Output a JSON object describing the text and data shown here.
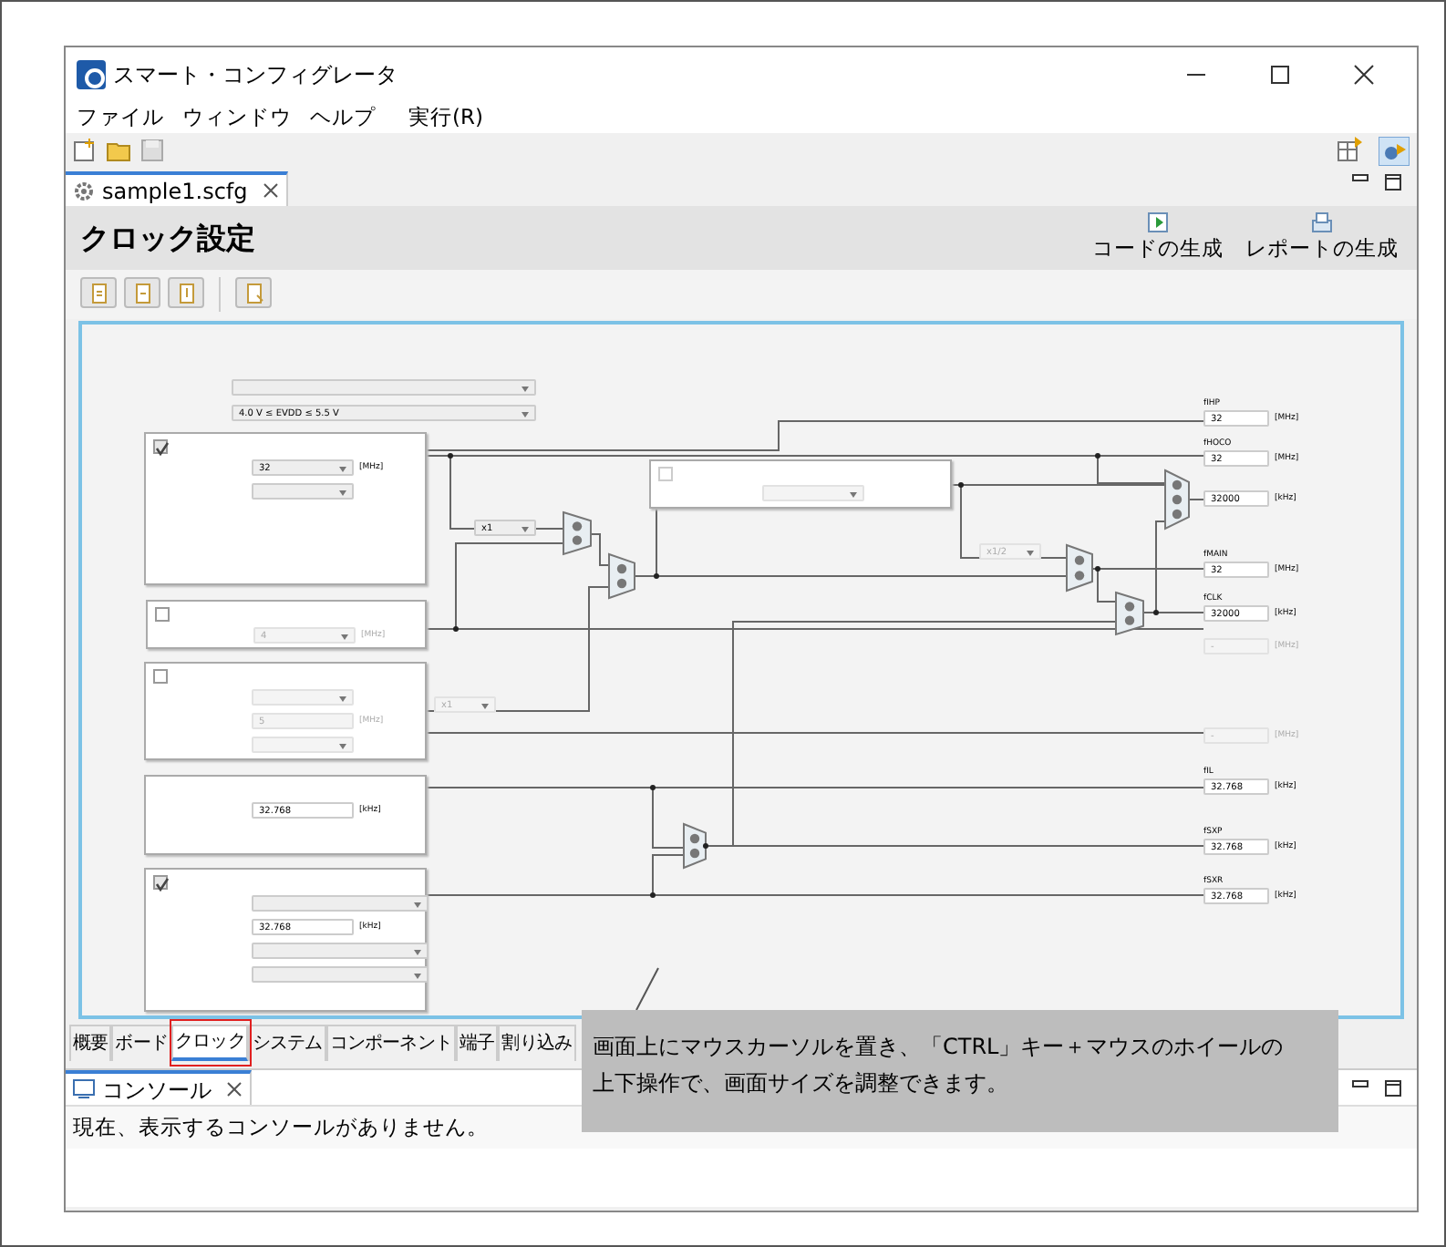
{
  "window": {
    "title": "スマート・コンフィグレータ"
  },
  "menu": [
    "ファイル",
    "ウィンドウ",
    "ヘルプ",
    "実行(R)"
  ],
  "editor_tab": {
    "label": "sample1.scfg",
    "selected": true
  },
  "page": {
    "title": "クロック設定",
    "actions": [
      "コードの生成",
      "レポートの生成"
    ]
  },
  "diagram": {
    "evdd_select": {
      "value": "4.0 V ≤ EVDD ≤ 5.5 V"
    },
    "panels": [
      {
        "kind": "checkbox",
        "checked": true,
        "fields": [
          {
            "kind": "select",
            "value": "32",
            "unit": "[MHz]"
          },
          {
            "kind": "select"
          }
        ]
      },
      {
        "kind": "checkbox",
        "checked": false,
        "fields": [
          {
            "kind": "select",
            "value": "4",
            "unit": "[MHz]"
          }
        ]
      },
      {
        "kind": "checkbox",
        "checked": false,
        "fields": [
          {
            "kind": "select"
          },
          {
            "kind": "input",
            "value": "5",
            "unit": "[MHz]"
          },
          {
            "kind": "select"
          }
        ]
      },
      {
        "kind": "plain",
        "fields": [
          {
            "kind": "input",
            "value": "32.768",
            "unit": "[kHz]"
          }
        ]
      },
      {
        "kind": "checkbox",
        "checked": true,
        "fields": [
          {
            "kind": "wide-select"
          },
          {
            "kind": "input",
            "value": "32.768",
            "unit": "[kHz]"
          },
          {
            "kind": "wide-select"
          },
          {
            "kind": "wide-select"
          }
        ]
      }
    ],
    "pll_panel": {
      "checked": false
    },
    "dividers": [
      {
        "value": "x1",
        "disabled": false
      },
      {
        "value": "x1/2",
        "disabled": true
      },
      {
        "value": "x1",
        "disabled": true
      }
    ],
    "outputs": [
      {
        "label": "fIHP",
        "value": "32",
        "unit": "[MHz]",
        "disabled": false
      },
      {
        "label": "fHOCO",
        "value": "32",
        "unit": "[MHz]",
        "disabled": false
      },
      {
        "value": "32000",
        "unit": "[kHz]",
        "disabled": false
      },
      {
        "label": "fMAIN",
        "value": "32",
        "unit": "[MHz]",
        "disabled": false
      },
      {
        "label": "fCLK",
        "value": "32000",
        "unit": "[kHz]",
        "disabled": false
      },
      {
        "value": "-",
        "unit": "[MHz]",
        "disabled": true
      },
      {
        "value": "-",
        "unit": "[MHz]",
        "disabled": true
      },
      {
        "label": "fIL",
        "value": "32.768",
        "unit": "[kHz]",
        "disabled": false
      },
      {
        "label": "fSXP",
        "value": "32.768",
        "unit": "[kHz]",
        "disabled": false
      },
      {
        "label": "fSXR",
        "value": "32.768",
        "unit": "[kHz]",
        "disabled": false
      }
    ]
  },
  "bottom_tabs": [
    {
      "label": "概要",
      "selected": false,
      "highlighted": false
    },
    {
      "label": "ボード",
      "selected": false,
      "highlighted": false
    },
    {
      "label": "クロック",
      "selected": true,
      "highlighted": true
    },
    {
      "label": "システム",
      "selected": false,
      "highlighted": false
    },
    {
      "label": "コンポーネント",
      "selected": false,
      "highlighted": false
    },
    {
      "label": "端子",
      "selected": false,
      "highlighted": false
    },
    {
      "label": "割り込み",
      "selected": false,
      "highlighted": false
    }
  ],
  "console": {
    "tab": "コンソール",
    "message": "現在、表示するコンソールがありません。"
  },
  "tooltip": {
    "text": "画面上にマウスカーソルを置き、「CTRL」キー＋マウスのホイールの上下操作で、画面サイズを調整できます。"
  }
}
